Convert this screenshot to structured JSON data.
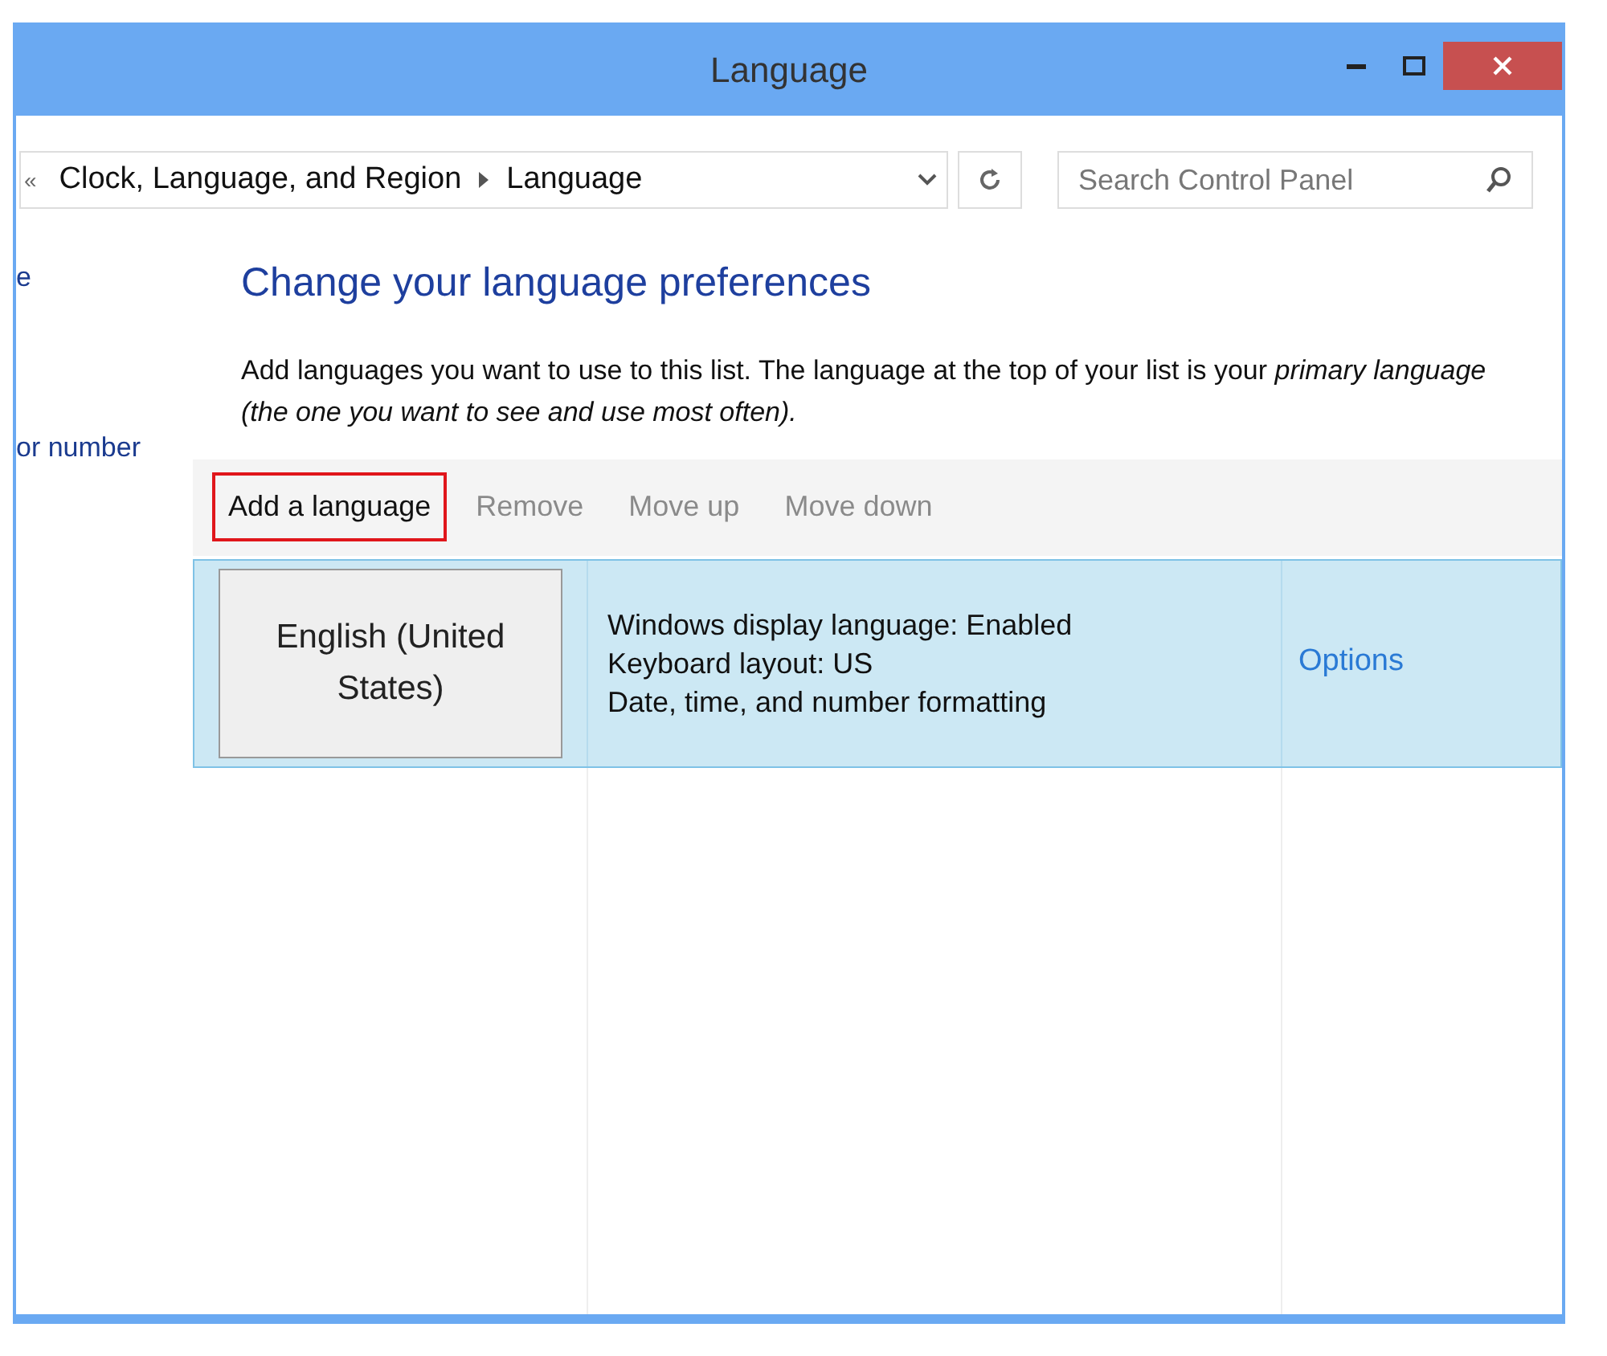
{
  "window": {
    "title": "Language"
  },
  "address_bar": {
    "overflow": "«",
    "crumbs": [
      "Clock, Language, and Region",
      "Language"
    ]
  },
  "search": {
    "placeholder": "Search Control Panel"
  },
  "sidebar": {
    "items": [
      "e",
      "or number"
    ]
  },
  "heading": "Change your language preferences",
  "description": "Add languages you want to use to this list. The language at the top of your list is your *primary language (the one you want to see and use most often).*",
  "toolbar": [
    {
      "label": "Add a language",
      "disabled": false,
      "highlighted": true
    },
    {
      "label": "Remove",
      "disabled": true,
      "highlighted": false
    },
    {
      "label": "Move up",
      "disabled": true,
      "highlighted": false
    },
    {
      "label": "Move down",
      "disabled": true,
      "highlighted": false
    }
  ],
  "languages": [
    {
      "name": "English (United States)",
      "selected": true,
      "details": [
        "Windows display language: Enabled",
        "Keyboard layout: US",
        "Date, time, and number formatting"
      ],
      "action": "Options"
    }
  ]
}
